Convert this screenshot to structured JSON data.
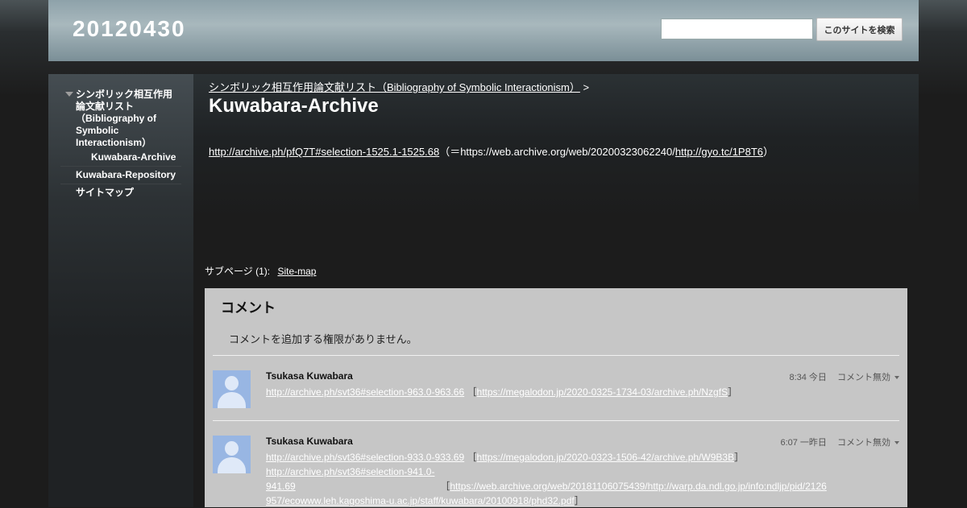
{
  "site": {
    "title": "20120430"
  },
  "search": {
    "placeholder": "",
    "button_label": "このサイトを検索"
  },
  "sidebar": {
    "items": [
      {
        "label": "シンボリック相互作用論文献リスト（Bibliography of Symbolic Interactionism）"
      },
      {
        "label": "Kuwabara-Archive"
      },
      {
        "label": "Kuwabara-Repository"
      },
      {
        "label": "サイトマップ"
      }
    ]
  },
  "breadcrumb": {
    "parent": "シンボリック相互作用論文献リスト（Bibliography of Symbolic Interactionism）",
    "separator": ">"
  },
  "page": {
    "title": "Kuwabara-Archive",
    "link1": "http://archive.ph/pfQ7T#selection-1525.1-1525.68",
    "text_mid": "（＝https://web.archive.org/web/20200323062240/",
    "link2": "http://gyo.tc/1P8T6",
    "text_end": "）"
  },
  "subpages": {
    "label": "サブページ (1):",
    "link": "Site-map"
  },
  "comments": {
    "title": "コメント",
    "no_permission": "コメントを追加する権限がありません。",
    "items": [
      {
        "author": "Tsukasa Kuwabara",
        "time": "8:34 今日",
        "action": "コメント無効",
        "link1": "http://archive.ph/svt36#selection-963.0-963.66",
        "link2": "https://megalodon.jp/2020-0325-1734-03/archive.ph/NzgfS"
      },
      {
        "author": "Tsukasa Kuwabara",
        "time": "6:07 一昨日",
        "action": "コメント無効",
        "link1": "http://archive.ph/svt36#selection-933.0-933.69",
        "link2": "https://megalodon.jp/2020-0323-1506-42/archive.ph/W9B3B",
        "link3": "http://archive.ph/svt36#selection-941.0-941.69",
        "link4": "https://web.archive.org/web/20181106075439/http://warp.da.ndl.go.jp/info:ndljp/pid/2126957/ecowww.leh.kagoshima-u.ac.jp/staff/kuwabara/20100918/phd32.pdf"
      }
    ]
  }
}
